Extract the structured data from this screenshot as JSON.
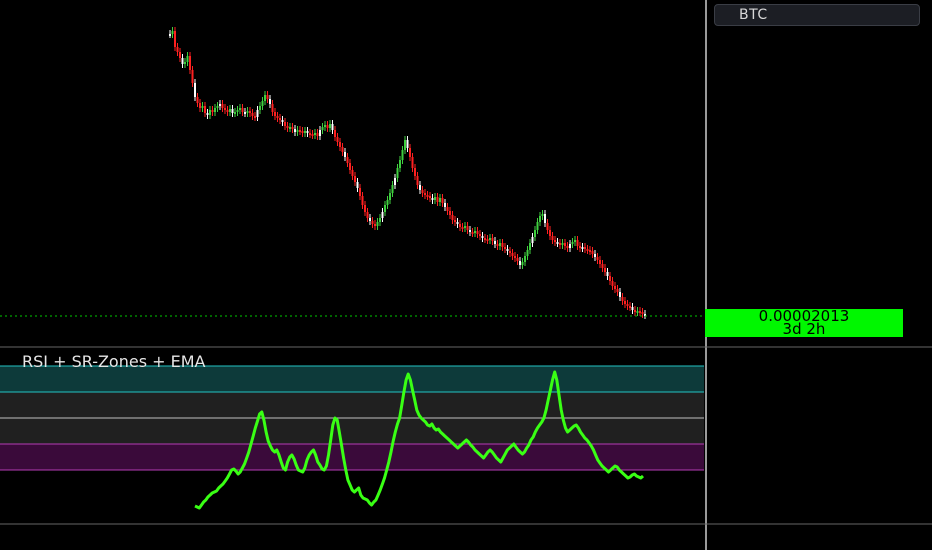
{
  "symbol": {
    "label": "BTC"
  },
  "price_tag": {
    "price": "0.00002013",
    "countdown": "3d 2h"
  },
  "indicator": {
    "title": "RSI + SR-Zones + EMA"
  },
  "colors": {
    "background": "#000000",
    "up_candle": "#3fd03f",
    "down_candle": "#ff2020",
    "neutral_candle": "#ffffff",
    "rsi_line": "#39ff14",
    "price_line": "#00c800",
    "zone_teal": "#0d3a3a",
    "zone_gray": "#202020",
    "zone_purple": "#3a0a3a",
    "separator": "#808080"
  },
  "chart_data": [
    {
      "type": "candlestick",
      "title": "",
      "series": [
        {
          "name": "",
          "close": [
            34,
            31,
            47,
            52,
            58,
            64,
            62,
            56,
            70,
            83,
            97,
            103,
            108,
            106,
            113,
            115,
            110,
            112,
            108,
            106,
            104,
            108,
            110,
            112,
            109,
            113,
            112,
            110,
            108,
            112,
            113,
            111,
            113,
            116,
            117,
            110,
            106,
            101,
            95,
            99,
            104,
            112,
            116,
            118,
            120,
            122,
            126,
            128,
            127,
            129,
            132,
            130,
            131,
            133,
            131,
            133,
            134,
            135,
            133,
            136,
            130,
            127,
            125,
            128,
            124,
            130,
            137,
            142,
            147,
            152,
            157,
            163,
            170,
            176,
            182,
            188,
            196,
            205,
            212,
            218,
            221,
            224,
            226,
            222,
            218,
            212,
            205,
            200,
            193,
            185,
            178,
            168,
            160,
            150,
            140,
            148,
            157,
            168,
            176,
            185,
            190,
            193,
            195,
            196,
            198,
            200,
            197,
            202,
            198,
            203,
            207,
            211,
            215,
            220,
            222,
            224,
            227,
            228,
            226,
            230,
            232,
            233,
            231,
            234,
            236,
            238,
            239,
            240,
            238,
            241,
            244,
            246,
            243,
            247,
            249,
            251,
            253,
            256,
            258,
            261,
            265,
            262,
            256,
            250,
            243,
            237,
            230,
            222,
            216,
            214,
            223,
            230,
            236,
            240,
            242,
            243,
            245,
            243,
            246,
            248,
            244,
            242,
            240,
            246,
            248,
            247,
            249,
            250,
            251,
            254,
            257,
            260,
            264,
            268,
            272,
            276,
            281,
            286,
            289,
            292,
            297,
            301,
            304,
            306,
            307,
            310,
            312,
            311,
            312,
            314,
            315
          ],
          "positioning": "declining trend"
        }
      ]
    },
    {
      "type": "line",
      "title": "",
      "series": [
        {
          "name": "",
          "values": [
            506,
            507,
            508,
            505,
            502,
            500,
            497,
            495,
            493,
            492,
            491,
            488,
            486,
            484,
            481,
            478,
            474,
            470,
            469,
            471,
            474,
            472,
            468,
            464,
            458,
            452,
            444,
            436,
            428,
            421,
            414,
            412,
            420,
            432,
            441,
            446,
            450,
            452,
            450,
            455,
            462,
            468,
            470,
            462,
            457,
            455,
            459,
            465,
            470,
            471,
            472,
            468,
            460,
            455,
            452,
            450,
            455,
            462,
            465,
            469,
            470,
            466,
            455,
            440,
            425,
            418,
            420,
            432,
            445,
            458,
            470,
            480,
            485,
            490,
            492,
            490,
            488,
            495,
            498,
            499,
            500,
            503,
            505,
            502,
            500,
            495,
            490,
            484,
            478,
            470,
            462,
            452,
            441,
            432,
            424,
            418,
            405,
            392,
            380,
            374,
            380,
            390,
            400,
            410,
            415,
            418,
            420,
            422,
            425,
            426,
            424,
            428,
            430,
            429,
            432,
            434,
            436,
            438,
            440,
            442,
            444,
            446,
            448,
            446,
            444,
            442,
            440,
            442,
            445,
            447,
            450,
            452,
            454,
            456,
            458,
            455,
            452,
            450,
            452,
            455,
            458,
            460,
            462,
            458,
            454,
            450,
            448,
            446,
            444,
            447,
            450,
            452,
            454,
            452,
            448,
            445,
            440,
            437,
            432,
            428,
            425,
            422,
            418,
            410,
            400,
            390,
            380,
            372,
            380,
            395,
            410,
            420,
            428,
            432,
            430,
            428,
            426,
            425,
            428,
            432,
            435,
            438,
            440,
            443,
            446,
            450,
            455,
            460,
            463,
            466,
            468,
            470,
            472,
            470,
            468,
            466,
            467,
            470,
            472,
            474,
            476,
            478,
            477,
            475,
            474,
            476,
            477,
            478,
            476
          ],
          "note": "RSI-like oscillator"
        }
      ]
    }
  ]
}
